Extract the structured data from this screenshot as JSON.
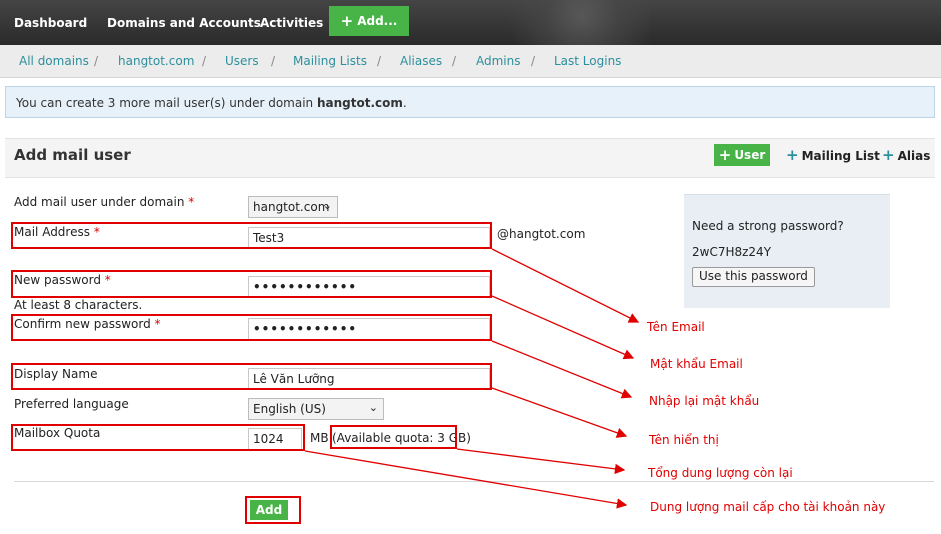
{
  "topnav": {
    "dashboard": "Dashboard",
    "domains_accounts": "Domains and Accounts",
    "activities": "Activities",
    "add": "Add..."
  },
  "breadcrumb": [
    "All domains",
    "hangtot.com",
    "Users",
    "Mailing Lists",
    "Aliases",
    "Admins",
    "Last Logins"
  ],
  "info": {
    "prefix": "You can create 3 more mail user(s) under domain ",
    "domain": "hangtot.com",
    "suffix": "."
  },
  "panel": {
    "title": "Add mail user",
    "user_button": "User",
    "mailing_list": "Mailing List",
    "alias": "Alias"
  },
  "form": {
    "domain_label": "Add mail user under domain",
    "domain_value": "hangtot.com",
    "mail_label": "Mail Address",
    "mail_value": "Test3",
    "mail_suffix": "@hangtot.com",
    "password_label": "New password",
    "password_dots": "••••••••••••",
    "password_hint": "At least 8 characters.",
    "confirm_label": "Confirm new password",
    "confirm_dots": "••••••••••••",
    "display_label": "Display Name",
    "display_value": "Lê Văn Lưỡng",
    "language_label": "Preferred language",
    "language_value": "English (US)",
    "quota_label": "Mailbox Quota",
    "quota_value": "1024",
    "quota_unit": "MB",
    "quota_available": "(Available quota: 3 GB)",
    "submit": "Add",
    "required_mark": "*"
  },
  "strong_password": {
    "title": "Need a strong password?",
    "value": "2wC7H8z24Y",
    "button": "Use this password"
  },
  "annotations": {
    "email": "Tên Email",
    "password": "Mật khẩu Email",
    "confirm": "Nhập lại mật khẩu",
    "display": "Tên hiển thị",
    "available": "Tổng dung lượng còn lại",
    "quota": "Dung lượng mail cấp cho tài khoản này"
  },
  "colors": {
    "accent_green": "#48b347",
    "link_teal": "#2c8f9c",
    "annotation_red": "#e10000",
    "topnav_dark": "#2f2f2f"
  },
  "icons": [
    "plus-icon",
    "chevron-down-icon"
  ]
}
